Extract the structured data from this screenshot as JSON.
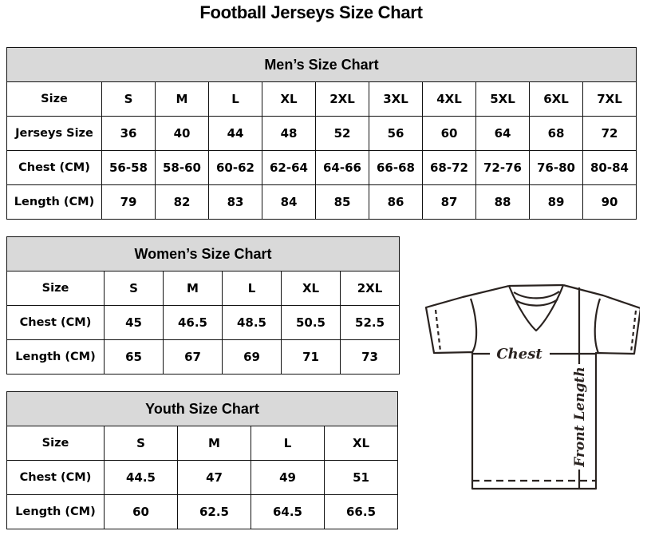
{
  "title": "Football Jerseys Size Chart",
  "mens": {
    "caption": "Men’s Size Chart",
    "rows": [
      {
        "label": "Size",
        "values": [
          "S",
          "M",
          "L",
          "XL",
          "2XL",
          "3XL",
          "4XL",
          "5XL",
          "6XL",
          "7XL"
        ]
      },
      {
        "label": "Jerseys Size",
        "values": [
          "36",
          "40",
          "44",
          "48",
          "52",
          "56",
          "60",
          "64",
          "68",
          "72"
        ]
      },
      {
        "label": "Chest (CM)",
        "values": [
          "56-58",
          "58-60",
          "60-62",
          "62-64",
          "64-66",
          "66-68",
          "68-72",
          "72-76",
          "76-80",
          "80-84"
        ]
      },
      {
        "label": "Length (CM)",
        "values": [
          "79",
          "82",
          "83",
          "84",
          "85",
          "86",
          "87",
          "88",
          "89",
          "90"
        ]
      }
    ]
  },
  "womens": {
    "caption": "Women’s Size Chart",
    "rows": [
      {
        "label": "Size",
        "values": [
          "S",
          "M",
          "L",
          "XL",
          "2XL"
        ]
      },
      {
        "label": "Chest (CM)",
        "values": [
          "45",
          "46.5",
          "48.5",
          "50.5",
          "52.5"
        ]
      },
      {
        "label": "Length (CM)",
        "values": [
          "65",
          "67",
          "69",
          "71",
          "73"
        ]
      }
    ]
  },
  "youth": {
    "caption": "Youth Size Chart",
    "rows": [
      {
        "label": "Size",
        "values": [
          "S",
          "M",
          "L",
          "XL"
        ]
      },
      {
        "label": "Chest (CM)",
        "values": [
          "44.5",
          "47",
          "49",
          "51"
        ]
      },
      {
        "label": "Length (CM)",
        "values": [
          "60",
          "62.5",
          "64.5",
          "66.5"
        ]
      }
    ]
  },
  "diagram": {
    "chest_label": "Chest",
    "length_label": "Front Length",
    "icon": "tshirt-measurement-diagram"
  }
}
